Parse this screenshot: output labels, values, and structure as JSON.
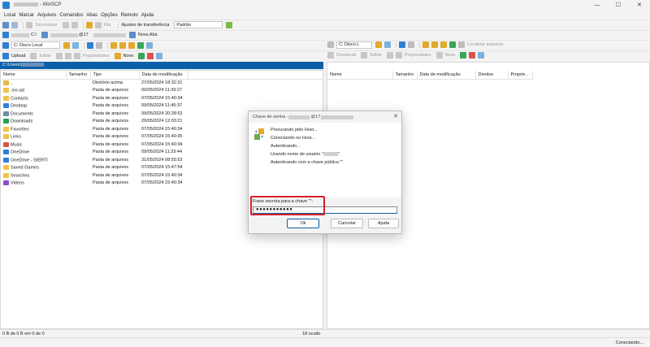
{
  "window": {
    "title": "- WinSCP",
    "controls": [
      "—",
      "☐",
      "✕"
    ]
  },
  "menu": [
    "Local",
    "Marcar",
    "Arquivos",
    "Comandos",
    "Abas",
    "Opções",
    "Remoto",
    "Ajuda"
  ],
  "toolbar1": {
    "sync_label": "Sincronizar",
    "queue_label": "Fila",
    "transfer_label": "Ajustes de transferência",
    "transfer_value": "Padrão"
  },
  "tabs": {
    "local_tab_suffix": "C:\\",
    "remote_tab_suffix": "@17",
    "new_tab": "Nova Aba"
  },
  "left_toolbar": {
    "drive": "C: Disco Local",
    "upload": "Upload",
    "edit": "Editar",
    "properties": "Propriedades",
    "new": "Novo"
  },
  "right_toolbar": {
    "drive": "C: Disco L",
    "find": "Localizar arquivos",
    "download": "Download",
    "edit": "Editar",
    "properties": "Propriedades",
    "new": "Novo"
  },
  "left_path": "C:\\Users\\",
  "left_columns": [
    "Nome",
    "Tamanho",
    "Tipo",
    "Data de modificação"
  ],
  "right_columns": [
    "Nome",
    "Tamanho",
    "Data de modificação",
    "Direitos",
    "Proprie..."
  ],
  "files": [
    {
      "name": "..",
      "type": "Diretório acima",
      "date": "27/05/2024 18:32:31",
      "color": "#e8b84a"
    },
    {
      "name": ".ms-ad",
      "type": "Pasta de arquivos",
      "date": "09/05/2024 11:39:27",
      "color": "#f1c24a"
    },
    {
      "name": "Contacts",
      "type": "Pasta de arquivos",
      "date": "07/05/2024 15:40:34",
      "color": "#f1c24a"
    },
    {
      "name": "Desktop",
      "type": "Pasta de arquivos",
      "date": "09/05/2024 11:45:37",
      "color": "#2f7fd3"
    },
    {
      "name": "Documents",
      "type": "Pasta de arquivos",
      "date": "09/05/2024 20:28:53",
      "color": "#6f8fa8"
    },
    {
      "name": "Downloads",
      "type": "Pasta de arquivos",
      "date": "29/05/2024 12:03:21",
      "color": "#2a9d57"
    },
    {
      "name": "Favorites",
      "type": "Pasta de arquivos",
      "date": "07/05/2024 15:40:34",
      "color": "#f1c24a"
    },
    {
      "name": "Links",
      "type": "Pasta de arquivos",
      "date": "07/05/2024 15:40:35",
      "color": "#f1c24a"
    },
    {
      "name": "Music",
      "type": "Pasta de arquivos",
      "date": "07/05/2024 15:40:34",
      "color": "#d9544c"
    },
    {
      "name": "OneDrive",
      "type": "Pasta de arquivos",
      "date": "09/05/2024 11:29:44",
      "color": "#2f7fd3"
    },
    {
      "name": "OneDrive - SIERTI",
      "type": "Pasta de arquivos",
      "date": "31/05/2024 08:55:53",
      "color": "#2f7fd3"
    },
    {
      "name": "Saved Games",
      "type": "Pasta de arquivos",
      "date": "07/05/2024 15:47:54",
      "color": "#f1c24a"
    },
    {
      "name": "Searches",
      "type": "Pasta de arquivos",
      "date": "07/05/2024 15:40:34",
      "color": "#f1c24a"
    },
    {
      "name": "Videos",
      "type": "Pasta de arquivos",
      "date": "07/05/2024 15:40:34",
      "color": "#8a4fc1"
    }
  ],
  "status": {
    "left": "0 B de 0 B em 0 de 0",
    "hidden": "18 oculto",
    "connection": "Conectando..."
  },
  "dialog": {
    "title_prefix": "Chave de senha -",
    "title_suffix": "@17",
    "lines": [
      "Procurando pelo Host...",
      "Conectando no Host...",
      "Autenticando...",
      "Usando nome de usuário \"",
      "Autenticando com a chave pública \"\"."
    ],
    "user_suffix": "\".",
    "passphrase_label": "Frase secreta para a chave \"\":",
    "passphrase_value": "●●●●●●●●●●●",
    "ok": "Ok",
    "cancel": "Cancelar",
    "help": "Ajuda"
  }
}
